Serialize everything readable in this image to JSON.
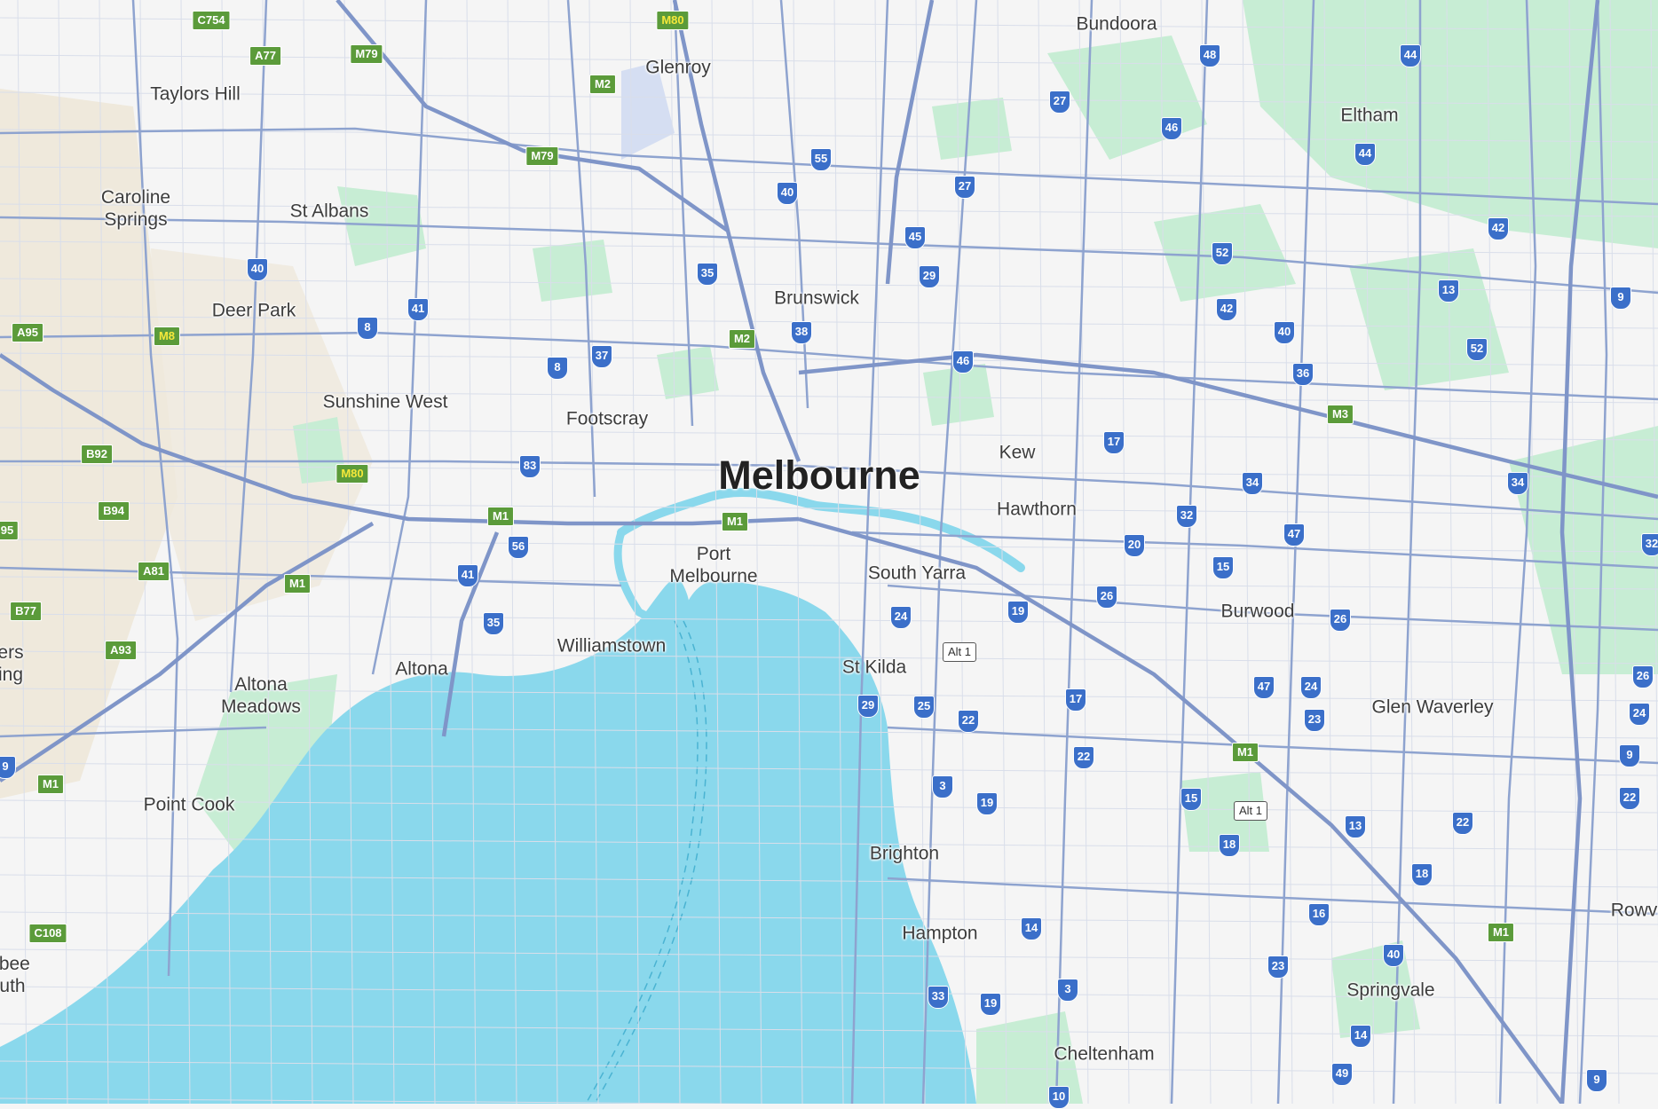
{
  "map": {
    "colors": {
      "land": "#f5f5f5",
      "water": "#8ad8ec",
      "park": "#c7edd4",
      "rural": "#efe9dc",
      "road": "#8ea3cf",
      "freeway": "#7f95c8",
      "route_shield": "#3b6fc9",
      "freeway_shield": "#5b9b3a"
    },
    "city": {
      "name": "Melbourne"
    },
    "places": [
      "Bundoora",
      "Glenroy",
      "Taylors Hill",
      "Eltham",
      "Caroline\nSprings",
      "St Albans",
      "Brunswick",
      "Deer Park",
      "Sunshine West",
      "Footscray",
      "Kew",
      "Hawthorn",
      "Port\nMelbourne",
      "South Yarra",
      "Burwood",
      "Williamstown",
      "St Kilda",
      "Altona",
      "Altona\nMeadows",
      "Glen Waverley",
      "Point Cook",
      "Brighton",
      "Rowvill",
      "Hampton",
      "Springvale",
      "Cheltenham",
      "ers\ning",
      "ibee\nuth"
    ],
    "route_shields": [
      "48",
      "44",
      "27",
      "46",
      "44",
      "55",
      "40",
      "27",
      "45",
      "42",
      "52",
      "29",
      "35",
      "13",
      "9",
      "40",
      "42",
      "41",
      "8",
      "38",
      "40",
      "37",
      "8",
      "46",
      "36",
      "52",
      "17",
      "83",
      "34",
      "34",
      "32",
      "47",
      "20",
      "56",
      "15",
      "32",
      "41",
      "26",
      "24",
      "19",
      "26",
      "35",
      "17",
      "24",
      "47",
      "26",
      "29",
      "25",
      "22",
      "23",
      "24",
      "22",
      "3",
      "19",
      "15",
      "13",
      "9",
      "22",
      "22",
      "18",
      "18",
      "16",
      "14",
      "3",
      "40",
      "23",
      "33",
      "19",
      "14",
      "10",
      "49",
      "9",
      "9"
    ],
    "freeway_shields": [
      "C754",
      "A77",
      "M79",
      "M2",
      "M79",
      "A95",
      "M2",
      "B92",
      "B94",
      "M1",
      "M1",
      "A81",
      "M1",
      "B77",
      "A93",
      "M3",
      "M1",
      "M1",
      "C108",
      "95",
      "M1"
    ],
    "yellow_shields": [
      "M80",
      "M8",
      "M80"
    ],
    "alt_shields": [
      "Alt 1",
      "Alt 1"
    ]
  }
}
